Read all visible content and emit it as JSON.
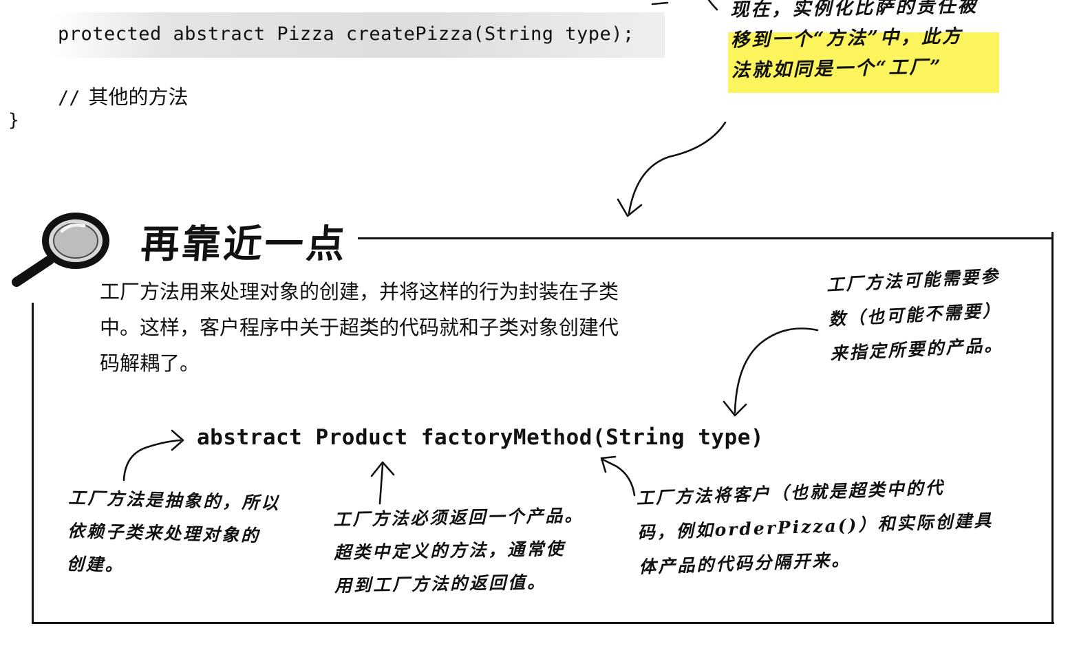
{
  "code": {
    "abstract_method": "protected abstract Pizza createPizza(String type);",
    "comment_slashes": "//",
    "comment_text": "其他的方法",
    "closing_brace": "}"
  },
  "top_note": {
    "lines": [
      "现在，实例化比萨的责任被",
      "移到一个“方法”中，此方",
      "法就如同是一个“工厂”"
    ],
    "highlight_color": "#fbf45c"
  },
  "section": {
    "title": "再靠近一点",
    "icon": "magnifying-glass-icon",
    "body_lines": [
      "工厂方法用来处理对象的创建，并将这样的行为封装在子类",
      "中。这样，客户程序中关于超类的代码就和子类对象创建代",
      "码解耦了。"
    ],
    "signature": "abstract Product factoryMethod(String type)"
  },
  "annotations": {
    "params": [
      "工厂方法可能需要参",
      "数（也可能不需要）",
      "来指定所要的产品。"
    ],
    "abstract": [
      "工厂方法是抽象的，所以",
      "依赖子类来处理对象的",
      "创建。"
    ],
    "return": [
      "工厂方法必须返回一个产品。",
      "超类中定义的方法，通常使",
      "用到工厂方法的返回值。"
    ],
    "decouple": [
      "工厂方法将客户（也就是超类中的代",
      "码，例如orderPizza()）和实际创建具",
      "体产品的代码分隔开来。"
    ]
  }
}
